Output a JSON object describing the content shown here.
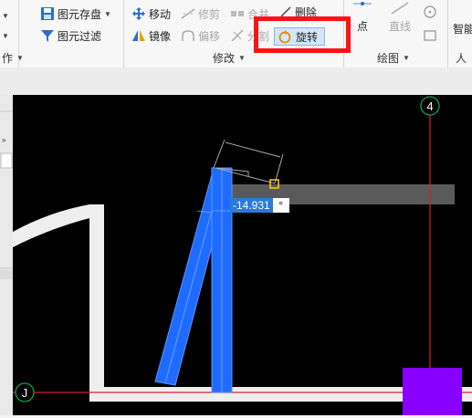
{
  "ribbon": {
    "save_element": "图元存盘",
    "filter_element": "图元过滤",
    "move": "移动",
    "trim": "修剪",
    "merge": "合并",
    "delete": "删除",
    "mirror": "镜像",
    "offset": "偏移",
    "split": "分割",
    "rotate": "旋转",
    "point": "点",
    "line": "直线",
    "smart": "智能",
    "person": "人",
    "groups": {
      "prev": "作",
      "modify": "修改",
      "draw": "绘图"
    }
  },
  "canvas": {
    "axis_4": "4",
    "axis_j": "J",
    "angle_value": "-14.931",
    "angle_unit": "°",
    "background": "#000000",
    "column_color": "#1f6bff",
    "axis_color": "#d81e2c",
    "selected_color": "#8800ff"
  },
  "icons": {
    "save": "save-icon",
    "filter": "filter-icon",
    "move": "move-icon",
    "trim": "trim-icon",
    "merge": "merge-icon",
    "delete": "delete-icon",
    "mirror": "mirror-icon",
    "offset": "offset-icon",
    "split": "split-icon",
    "rotate": "rotate-icon",
    "point": "point-icon",
    "line": "line-icon",
    "circle": "circle-icon",
    "rectangle": "rectangle-icon"
  }
}
